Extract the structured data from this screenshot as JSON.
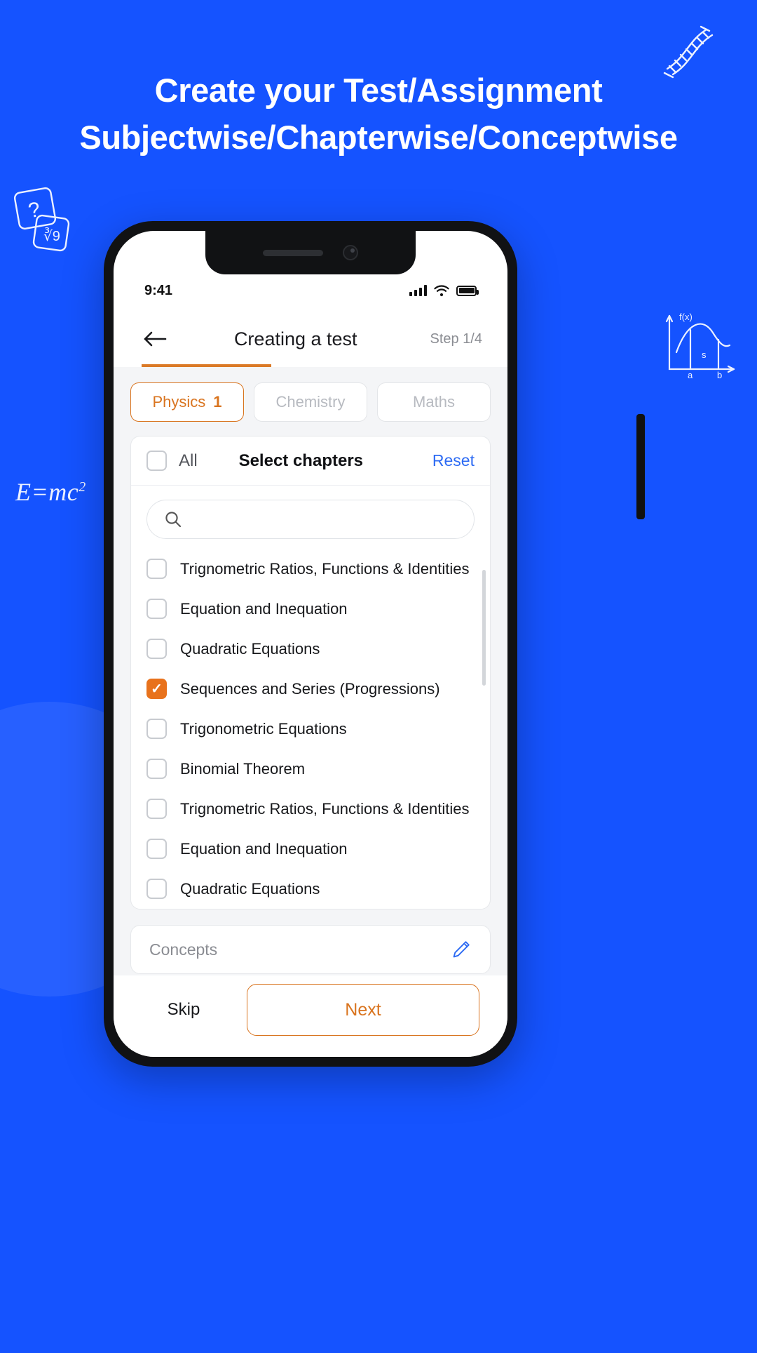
{
  "headline": {
    "line1": "Create your Test/Assignment",
    "line2": "Subjectwise/Chapterwise/Conceptwise"
  },
  "doodles": {
    "dna": "dna-doodle",
    "question": "question-block-doodle",
    "emc": "E=mc",
    "emc_sup": "2",
    "fx": "fx-graph-doodle",
    "fx_label": "f(x)",
    "fx_s": "s",
    "fx_a": "a",
    "fx_b": "b"
  },
  "status_bar": {
    "time": "9:41",
    "signal_icon": "signal-bars-icon",
    "wifi_icon": "wifi-icon",
    "battery_icon": "battery-icon"
  },
  "header": {
    "back_icon": "back-arrow-icon",
    "title": "Creating a test",
    "step": "Step 1/4",
    "progress_percent": 33
  },
  "tabs": [
    {
      "label": "Physics",
      "count": "1",
      "active": true
    },
    {
      "label": "Chemistry",
      "count": "",
      "active": false
    },
    {
      "label": "Maths",
      "count": "",
      "active": false
    }
  ],
  "chapters_card": {
    "all_label": "All",
    "all_checked": false,
    "title": "Select chapters",
    "reset_label": "Reset",
    "search": {
      "placeholder": "",
      "value": "",
      "icon": "search-icon"
    },
    "items": [
      {
        "label": "Trignometric Ratios, Functions & Identities",
        "checked": false
      },
      {
        "label": "Equation and Inequation",
        "checked": false
      },
      {
        "label": "Quadratic Equations",
        "checked": false
      },
      {
        "label": "Sequences and Series (Progressions)",
        "checked": true
      },
      {
        "label": "Trigonometric Equations",
        "checked": false
      },
      {
        "label": "Binomial Theorem",
        "checked": false
      },
      {
        "label": "Trignometric Ratios, Functions & Identities",
        "checked": false
      },
      {
        "label": "Equation and Inequation",
        "checked": false
      },
      {
        "label": "Quadratic Equations",
        "checked": false
      }
    ]
  },
  "concepts": {
    "placeholder": "Concepts",
    "edit_icon": "pencil-edit-icon"
  },
  "footer": {
    "skip_label": "Skip",
    "next_label": "Next"
  },
  "colors": {
    "background": "#1553FF",
    "accent_orange": "#D9741F",
    "checkbox_orange": "#E8721C",
    "link_blue": "#2D6BF3",
    "edit_blue": "#2D6BF3"
  }
}
